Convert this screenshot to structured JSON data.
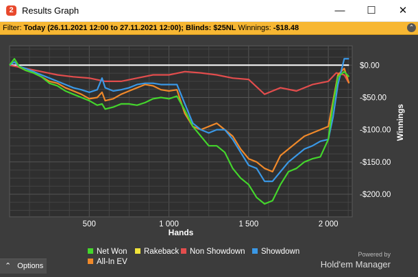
{
  "window": {
    "title": "Results Graph",
    "app_icon": "hem2-icon",
    "minimize_glyph": "—",
    "maximize_glyph": "☐",
    "close_glyph": "✕"
  },
  "filter": {
    "prefix": "Filter:",
    "date_range": "Today (26.11.2021 12:00 to 27.11.2021 12:00);",
    "blinds": "Blinds: $25NL",
    "winnings_label": "Winnings:",
    "winnings_value": "-$18.48",
    "collapse_glyph": "⌃"
  },
  "chart_data": {
    "type": "line",
    "xlabel": "Hands",
    "ylabel": "Winnings",
    "x_ticks": [
      "500",
      "1 000",
      "1 500",
      "2 000"
    ],
    "x_tick_values": [
      500,
      1000,
      1500,
      2000
    ],
    "y_ticks": [
      "$0.00",
      "-$50.00",
      "-$100.00",
      "-$150.00",
      "-$200.00"
    ],
    "y_tick_values": [
      0,
      -50,
      -100,
      -150,
      -200
    ],
    "xlim": [
      0,
      2150
    ],
    "ylim": [
      -235,
      30
    ],
    "grid": true,
    "legend_position": "bottom",
    "series": [
      {
        "name": "Net Won",
        "color": "#44d62c",
        "x": [
          0,
          30,
          60,
          100,
          150,
          200,
          250,
          300,
          350,
          400,
          450,
          500,
          550,
          580,
          600,
          650,
          700,
          750,
          800,
          850,
          900,
          950,
          1000,
          1050,
          1100,
          1130,
          1150,
          1200,
          1250,
          1300,
          1350,
          1400,
          1450,
          1500,
          1550,
          1600,
          1650,
          1700,
          1750,
          1800,
          1850,
          1900,
          1950,
          2000,
          2030,
          2060,
          2100,
          2130
        ],
        "y": [
          0,
          10,
          -2,
          -8,
          -12,
          -18,
          -28,
          -32,
          -40,
          -45,
          -50,
          -55,
          -62,
          -60,
          -68,
          -65,
          -60,
          -60,
          -62,
          -58,
          -52,
          -50,
          -52,
          -48,
          -70,
          -85,
          -95,
          -110,
          -125,
          -125,
          -135,
          -160,
          -175,
          -185,
          -205,
          -215,
          -210,
          -185,
          -165,
          -160,
          -150,
          -145,
          -142,
          -115,
          -60,
          -18,
          -10,
          -18
        ]
      },
      {
        "name": "Rakeback",
        "color": "#f1e43a",
        "x": [
          0,
          2130
        ],
        "y": [
          0,
          0
        ]
      },
      {
        "name": "Non Showdown",
        "color": "#e34d4d",
        "x": [
          0,
          100,
          200,
          300,
          400,
          500,
          600,
          700,
          800,
          900,
          1000,
          1100,
          1200,
          1300,
          1400,
          1500,
          1600,
          1650,
          1700,
          1800,
          1900,
          2000,
          2050,
          2100,
          2130
        ],
        "y": [
          0,
          -5,
          -10,
          -15,
          -18,
          -20,
          -25,
          -25,
          -20,
          -15,
          -15,
          -10,
          -12,
          -15,
          -20,
          -22,
          -45,
          -40,
          -35,
          -40,
          -30,
          -25,
          -12,
          -15,
          -28
        ]
      },
      {
        "name": "Showdown",
        "color": "#3a98e6",
        "x": [
          0,
          30,
          60,
          100,
          150,
          200,
          250,
          300,
          350,
          400,
          450,
          500,
          550,
          580,
          600,
          650,
          700,
          750,
          800,
          850,
          900,
          950,
          1000,
          1050,
          1100,
          1150,
          1200,
          1250,
          1300,
          1350,
          1400,
          1450,
          1500,
          1550,
          1600,
          1650,
          1700,
          1750,
          1800,
          1850,
          1900,
          1950,
          2000,
          2030,
          2060,
          2100,
          2130
        ],
        "y": [
          0,
          5,
          -2,
          -5,
          -10,
          -15,
          -20,
          -25,
          -30,
          -35,
          -38,
          -42,
          -38,
          -20,
          -35,
          -40,
          -38,
          -35,
          -30,
          -28,
          -28,
          -30,
          -30,
          -30,
          -60,
          -90,
          -100,
          -105,
          -100,
          -100,
          -115,
          -135,
          -155,
          -160,
          -180,
          -180,
          -165,
          -150,
          -140,
          -130,
          -125,
          -118,
          -115,
          -80,
          -30,
          10,
          10
        ]
      },
      {
        "name": "All-In EV",
        "color": "#f0892a",
        "x": [
          0,
          30,
          60,
          100,
          150,
          200,
          250,
          300,
          350,
          400,
          450,
          500,
          550,
          580,
          600,
          650,
          700,
          750,
          800,
          850,
          900,
          950,
          1000,
          1050,
          1100,
          1150,
          1200,
          1250,
          1300,
          1350,
          1400,
          1450,
          1500,
          1550,
          1600,
          1650,
          1700,
          1750,
          1800,
          1850,
          1900,
          1950,
          2000,
          2030,
          2060,
          2100,
          2130
        ],
        "y": [
          0,
          5,
          -3,
          -8,
          -12,
          -18,
          -25,
          -28,
          -35,
          -40,
          -45,
          -52,
          -50,
          -42,
          -55,
          -52,
          -45,
          -40,
          -35,
          -30,
          -32,
          -38,
          -40,
          -38,
          -75,
          -95,
          -100,
          -95,
          -90,
          -100,
          -110,
          -130,
          -145,
          -150,
          -160,
          -165,
          -140,
          -130,
          -120,
          -110,
          -105,
          -100,
          -95,
          -55,
          -15,
          -5,
          -28
        ]
      }
    ]
  },
  "legend": [
    {
      "label": "Net Won",
      "color": "#44d62c"
    },
    {
      "label": "Rakeback",
      "color": "#f1e43a"
    },
    {
      "label": "Non Showdown",
      "color": "#e34d4d"
    },
    {
      "label": "Showdown",
      "color": "#3a98e6"
    },
    {
      "label": "All-In EV",
      "color": "#f0892a"
    }
  ],
  "footer": {
    "options_label": "Options",
    "options_glyph": "⌃",
    "powered_by": "Powered by",
    "brand_name": "Hold'em Manager",
    "brand_logo_text": "2"
  }
}
